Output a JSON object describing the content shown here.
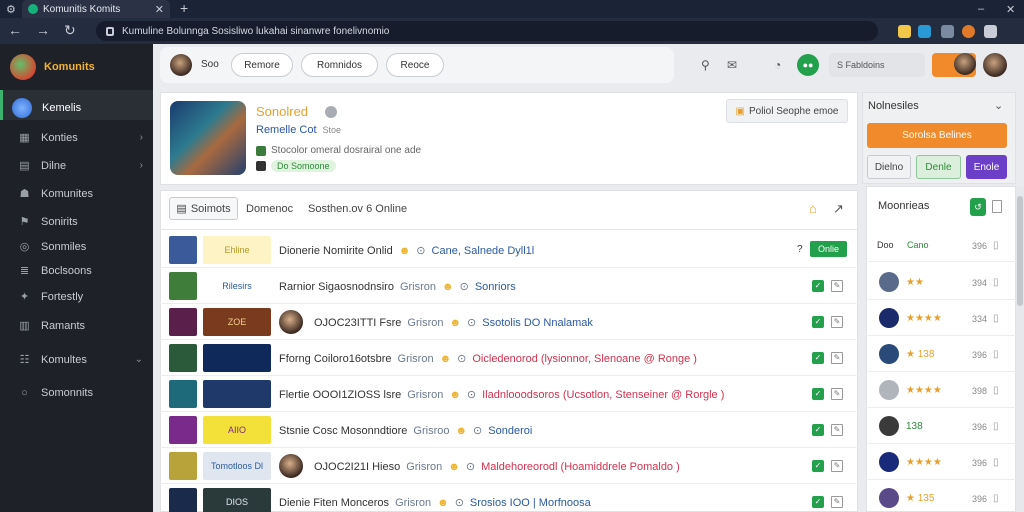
{
  "browser": {
    "tab_title": "Komunitis Komits",
    "new_tab": "+",
    "url": "Kumuline Bolunnga Sosisliwo lukahai sinanwre fonelivnomio"
  },
  "sidebar": {
    "brand": "Komunits",
    "items": [
      {
        "label": "Kemelis",
        "icon": "globe-icon",
        "chevron": ""
      },
      {
        "label": "Konties",
        "icon": "grid-icon",
        "chevron": "›"
      },
      {
        "label": "Dilne",
        "icon": "book-icon",
        "chevron": "›"
      },
      {
        "label": "Komunites",
        "icon": "users-icon",
        "chevron": ""
      },
      {
        "label": "Sonirits",
        "icon": "flag-icon",
        "chevron": ""
      },
      {
        "label": "Sonmiles",
        "icon": "target-icon",
        "chevron": ""
      },
      {
        "label": "Boclsoons",
        "icon": "list-icon",
        "chevron": ""
      },
      {
        "label": "Fortestly",
        "icon": "pin-icon",
        "chevron": ""
      },
      {
        "label": "Ramants",
        "icon": "chart-icon",
        "chevron": ""
      },
      {
        "label": "Komultes",
        "icon": "group-icon",
        "chevron": "⌄"
      },
      {
        "label": "Somonnits",
        "icon": "circle-icon",
        "chevron": ""
      }
    ]
  },
  "header": {
    "user_label": "Soo",
    "pills": [
      "Remore",
      "Romnidos",
      "Reoce"
    ],
    "search_placeholder": "S Fabldoins"
  },
  "profile": {
    "name": "Sonolred",
    "subtitle": "Remelle Cot",
    "subtitle_extra": "Stoe",
    "description": "Stocolor omeral dosrairal one ade",
    "badge": "Do Somoone",
    "action": "Poliol Seophe emoe"
  },
  "list": {
    "tabs": [
      "Soimots",
      "Domenoc",
      "Sosthen.ov 6 Online"
    ],
    "rows": [
      {
        "img_label": "Ehline",
        "text": "Dionerie Nomirite Onlid",
        "suffix": "Cane, Salnede Dyll1l",
        "flag": "?",
        "online": "Onlie",
        "thumb": "#3b5a9a",
        "img_bg": "#fdf3c4",
        "img_fg": "#b89a2a",
        "avatar": false,
        "suffix_color": "b",
        "show_ctrl": false
      },
      {
        "img_label": "Rilesirs",
        "text": "Rarnior Sigaosnodnsiro",
        "origin": "Grisron",
        "suffix": "Sonriors",
        "thumb": "#3f7d3a",
        "img_bg": "#ffffff",
        "img_fg": "#2c5aa0",
        "avatar": false,
        "suffix_color": "b",
        "show_ctrl": true
      },
      {
        "img_label": "ZOE",
        "text": "OJOC23ITTI Fsre",
        "origin": "Grisron",
        "suffix": "Ssotolis DO Nnalamak",
        "thumb": "#5a1f4a",
        "img_bg": "#7a3a1e",
        "img_fg": "#f4d08a",
        "avatar": true,
        "suffix_color": "b",
        "show_ctrl": true
      },
      {
        "img_label": "",
        "text": "Fforng Coiloro16otsbre",
        "origin": "Grisron",
        "suffix": "Oicledenorod (lysionnor, Slenoane @ Ronge )",
        "thumb": "#2a5a3a",
        "img_bg": "#0f2a5a",
        "img_fg": "#8fd0ff",
        "avatar": false,
        "suffix_color": "r",
        "show_ctrl": true
      },
      {
        "img_label": "",
        "text": "Flertie OOOI1ZIOSS lsre",
        "origin": "Grisron",
        "suffix": "Iladnlooodsoros (Ucsotlon, Stenseiner @ Rorgle )",
        "thumb": "#1f6a7a",
        "img_bg": "#1f3a6a",
        "img_fg": "#ffffff",
        "avatar": false,
        "suffix_color": "r",
        "show_ctrl": true
      },
      {
        "img_label": "AIIO",
        "text": "Stsnie Cosc Mosonndtiore",
        "origin": "Grisroo",
        "suffix": "Sonderoi",
        "thumb": "#7a2a8a",
        "img_bg": "#f3e13a",
        "img_fg": "#7a2a8a",
        "avatar": false,
        "suffix_color": "b",
        "show_ctrl": true
      },
      {
        "img_label": "Tomotloos Dl",
        "text": "OJOC2I21I Hieso",
        "origin": "Grisron",
        "suffix": "Maldehoreorodl (Hoamiddrele Pomaldo )",
        "thumb": "#b8a23a",
        "img_bg": "#dfe6f0",
        "img_fg": "#2c5aa0",
        "avatar": true,
        "suffix_color": "r",
        "show_ctrl": true
      },
      {
        "img_label": "DIOS",
        "text": "Dienie Fiten Monceros",
        "origin": "Grisron",
        "suffix": "Srosios IOO | Morfnoosa",
        "thumb": "#1a2a4a",
        "img_bg": "#2a3a3a",
        "img_fg": "#dfe6f0",
        "avatar": false,
        "suffix_color": "b",
        "show_ctrl": true
      }
    ]
  },
  "right_panel": {
    "title": "Nolnesiles",
    "close": "⌄",
    "primary": "Sorolsa Belines",
    "buttons": [
      "Dielno",
      "Denle",
      "Enole"
    ],
    "list_title": "Moonrieas",
    "list_header": {
      "left": "Doo",
      "sub": "Cano",
      "num": "396"
    },
    "rows": [
      {
        "stars": "★★",
        "num": "394",
        "av": "#5a6a8a"
      },
      {
        "stars": "★★★★",
        "num": "334",
        "av": "#1a2a6a"
      },
      {
        "stars": "★ 138",
        "num": "396",
        "av": "#2a4a7a"
      },
      {
        "stars": "★★★★",
        "num": "398",
        "av": "#b0b4bb"
      },
      {
        "stars": "138",
        "num": "396",
        "av": "#3a3a3a"
      },
      {
        "stars": "★★★★",
        "num": "396",
        "av": "#1a2a7a"
      },
      {
        "stars": "★ 135",
        "num": "396",
        "av": "#5a4a8a"
      }
    ],
    "accent": "#f08a2a",
    "success": "#22a04b",
    "purple": "#6c3fc9"
  }
}
